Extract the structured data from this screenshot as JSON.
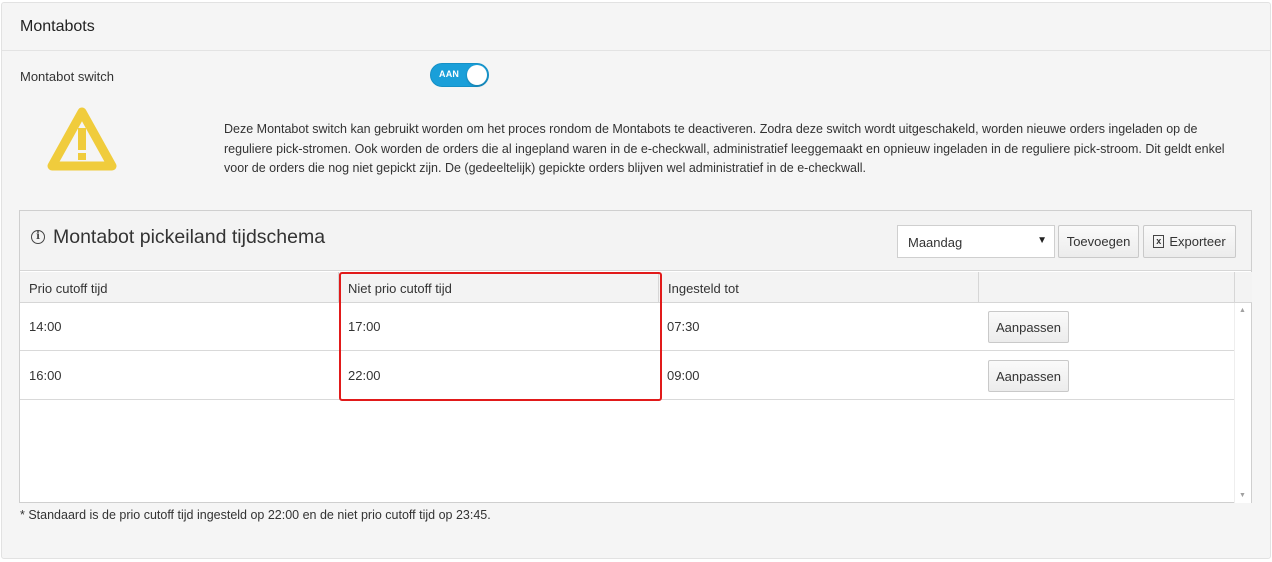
{
  "panel": {
    "title": "Montabots",
    "switch_label": "Montabot switch",
    "toggle_text": "AAN",
    "toggle_on": true,
    "info_text": "Deze Montabot switch kan gebruikt worden om het proces rondom de Montabots te deactiveren. Zodra deze switch wordt uitgeschakeld, worden nieuwe orders ingeladen op de reguliere pick-stromen. Ook worden de orders die al ingepland waren in de e-checkwall, administratief leeggemaakt en opnieuw ingeladen in de reguliere pick-stroom. Dit geldt enkel voor de orders die nog niet gepickt zijn. De (gedeeltelijk) gepickte orders blijven wel administratief in de e-checkwall."
  },
  "widget": {
    "title": "Montabot pickeiland tijdschema",
    "day_select": "Maandag",
    "add_label": "Toevoegen",
    "export_label": "Exporteer",
    "columns": [
      "Prio cutoff tijd",
      "Niet prio cutoff tijd",
      "Ingesteld tot",
      ""
    ],
    "rows": [
      {
        "prio": "14:00",
        "niet_prio": "17:00",
        "tot": "07:30",
        "action": "Aanpassen"
      },
      {
        "prio": "16:00",
        "niet_prio": "22:00",
        "tot": "09:00",
        "action": "Aanpassen"
      }
    ]
  },
  "footnote": "* Standaard is de prio cutoff tijd ingesteld op 22:00 en de niet prio cutoff tijd op 23:45.",
  "colors": {
    "toggle_on": "#1a9fd9",
    "warning": "#f0cc3c",
    "highlight": "#e11a1a"
  },
  "icons": {
    "warning": "warning-triangle-icon",
    "info": "info-circle-icon",
    "export": "excel-file-icon",
    "dropdown": "chevron-down-icon"
  }
}
